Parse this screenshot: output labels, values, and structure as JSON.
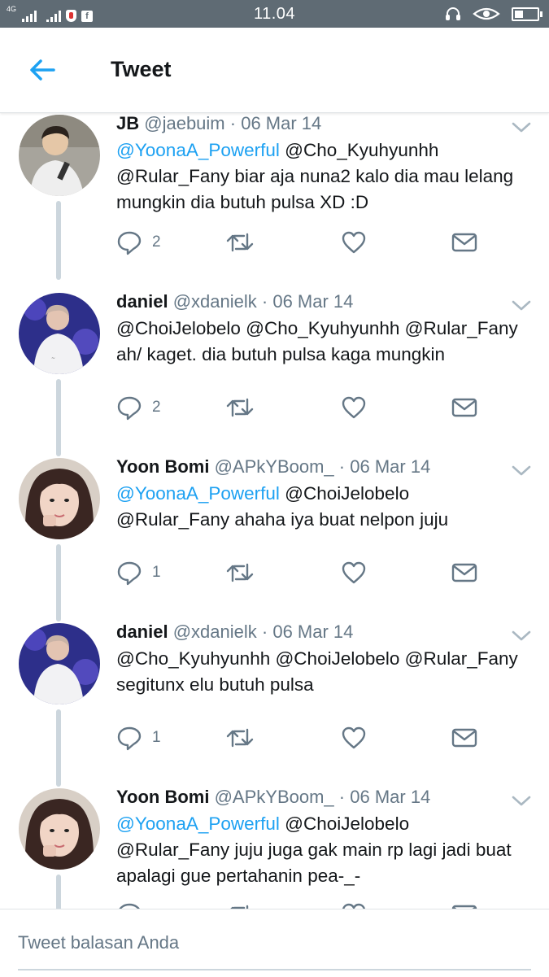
{
  "status_bar": {
    "network": "4G",
    "time": "11.04",
    "icons": [
      "signal-icon",
      "signal-icon",
      "shield-icon",
      "facebook-icon",
      "headset-icon",
      "eye-icon",
      "battery-icon"
    ]
  },
  "header": {
    "title": "Tweet",
    "back_icon": "arrow-left-icon"
  },
  "colors": {
    "accent": "#1da1f2",
    "text": "#14171a",
    "muted": "#657786",
    "thread": "#ccd6dd",
    "status_bar": "#5f6b74"
  },
  "tweets": [
    {
      "name": "JB",
      "handle": "@jaebuim",
      "separator": "·",
      "date": "06 Mar 14",
      "lines": [
        {
          "mention": "@YoonaA_Powerful",
          "text": " @Cho_Kyuhyunhh"
        },
        {
          "mention": "",
          "text": "@Rular_Fany biar aja nuna2 kalo dia mau lelang"
        },
        {
          "mention": "",
          "text": "mungkin dia butuh pulsa XD :D"
        }
      ],
      "reply_count": "2"
    },
    {
      "name": "daniel",
      "handle": "@xdanielk",
      "separator": "·",
      "date": "06 Mar 14",
      "lines": [
        {
          "mention": "",
          "text": "@ChoiJelobelo @Cho_Kyuhyunhh @Rular_Fany"
        },
        {
          "mention": "",
          "text": "ah/ kaget. dia butuh pulsa kaga mungkin"
        }
      ],
      "reply_count": "2"
    },
    {
      "name": "Yoon Bomi",
      "handle": "@APkYBoom_",
      "separator": "·",
      "date": "06 Mar 14",
      "lines": [
        {
          "mention": "@YoonaA_Powerful",
          "text": " @ChoiJelobelo"
        },
        {
          "mention": "",
          "text": "@Rular_Fany ahaha iya buat nelpon juju"
        }
      ],
      "reply_count": "1"
    },
    {
      "name": "daniel",
      "handle": "@xdanielk",
      "separator": "·",
      "date": "06 Mar 14",
      "lines": [
        {
          "mention": "",
          "text": "@Cho_Kyuhyunhh @ChoiJelobelo @Rular_Fany"
        },
        {
          "mention": "",
          "text": "segitunx elu butuh pulsa"
        }
      ],
      "reply_count": "1"
    },
    {
      "name": "Yoon Bomi",
      "handle": "@APkYBoom_",
      "separator": "·",
      "date": "06 Mar 14",
      "lines": [
        {
          "mention": "@YoonaA_Powerful",
          "text": " @ChoiJelobelo"
        },
        {
          "mention": "",
          "text": "@Rular_Fany juju juga gak main rp lagi jadi buat"
        },
        {
          "mention": "",
          "text": "apalagi gue pertahanin pea-_-"
        }
      ],
      "reply_count": ""
    }
  ],
  "reply_bar": {
    "placeholder": "Tweet balasan Anda"
  }
}
